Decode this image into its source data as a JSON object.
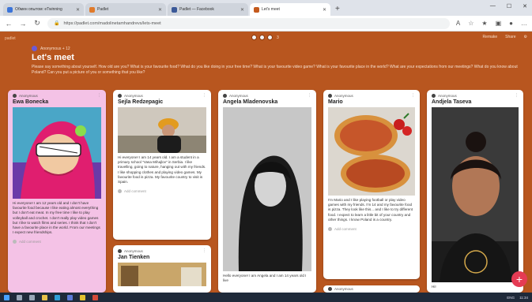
{
  "browser": {
    "tabs": [
      {
        "label": "Обмен опытом: eTwinning",
        "color": "#3b74d9",
        "active": false
      },
      {
        "label": "Padlet",
        "color": "#e07a2a",
        "active": false
      },
      {
        "label": "Padlet — Facebook",
        "color": "#3b5998",
        "active": false
      },
      {
        "label": "Let's meet",
        "color": "#c45a1d",
        "active": true
      }
    ],
    "url": "https://padlet.com/madolinetamhandrevs/lets-meet",
    "winctl": [
      "—",
      "☐",
      "✕"
    ]
  },
  "padlet": {
    "brand": "padlet",
    "reaction_count": "3",
    "right_actions": [
      "Remake",
      "Share",
      "⚙"
    ],
    "author": "Anonymous + 12",
    "title": "Let's meet",
    "description": "Please say something about yourself. How old are you? What is your favourite food? What do you like doing in your free time? What is your favourite video game? What is your favourite place in the world? What are your expectations from our meetings? What do you know about Poland? Can you put a picture of you or something that you like?"
  },
  "columns": [
    {
      "cards": [
        {
          "anon": "Anonymous",
          "title": "Ewa Bonecka",
          "image": "illustration",
          "body": "Hi everyone! I am 12 years old and I don't have favourite food because I like eating almost everything but I don't eat meat. In my free time I like to play volleyball and crochet. I don't really play video games but I like to watch films and series. I think that I don't have a favourite place in the world. From our meetings I expect new friendships.",
          "foot": "Add comment"
        }
      ]
    },
    {
      "cards": [
        {
          "anon": "Anonymous",
          "title": "Sejla Redzepagic",
          "image": "girl-hat",
          "body": "Hi everyone! I am 14 years old. I am a student in a primary school \"Vasa Mihajlov\" in Serbia. I like travelling, going to nature, hanging out with my friends. I like shopping clothes and playing video games. My favourite food is pizza. My favourite country to visit is Spain.",
          "foot": "Add comment"
        },
        {
          "anon": "Anonymous",
          "title": "Jan Tienken",
          "image": "room",
          "body": "",
          "foot": ""
        }
      ]
    },
    {
      "cards": [
        {
          "anon": "Anonymous",
          "title": "Angela Mladenovska",
          "image": "bw-portrait",
          "body": "Hello everyone! I am Angela and I am 14 years old I live",
          "foot": ""
        }
      ]
    },
    {
      "cards": [
        {
          "anon": "Anonymous",
          "title": "Mario",
          "image": "pizza",
          "body": "I'm Mario and I like playing football or play video games with my friends. I'm 14 and my favourite food is pizza. They look like this... and I like to try different food. I expect to learn a little bit of your country and other things. I know Poland is a country.",
          "foot": "Add comment"
        },
        {
          "anon": "Anonymous",
          "title": "",
          "image": "",
          "body": "",
          "foot": ""
        }
      ]
    },
    {
      "cards": [
        {
          "anon": "Anonymous",
          "title": "Andjela Taseva",
          "image": "bun-portrait",
          "body": "Hi!",
          "foot": ""
        }
      ]
    }
  ],
  "taskbar": {
    "tray": [
      "ENG",
      "11:34"
    ]
  }
}
